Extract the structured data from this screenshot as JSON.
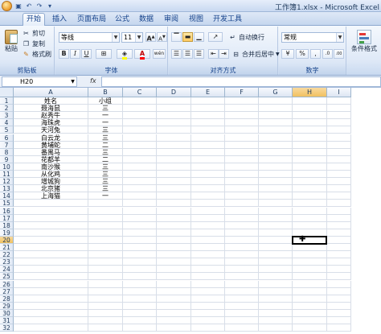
{
  "window": {
    "title": "工作簿1.xlsx - Microsoft Excel"
  },
  "tabs": [
    {
      "label": "开始",
      "active": true
    },
    {
      "label": "插入",
      "active": false
    },
    {
      "label": "页面布局",
      "active": false
    },
    {
      "label": "公式",
      "active": false
    },
    {
      "label": "数据",
      "active": false
    },
    {
      "label": "审阅",
      "active": false
    },
    {
      "label": "视图",
      "active": false
    },
    {
      "label": "开发工具",
      "active": false
    }
  ],
  "ribbon": {
    "clipboard": {
      "label": "剪贴板",
      "paste": "粘贴",
      "cut": "剪切",
      "copy": "复制",
      "format_painter": "格式刷"
    },
    "font": {
      "label": "字体",
      "font_name": "等线",
      "font_size": "11",
      "bold": "B",
      "italic": "I",
      "underline": "U",
      "grow": "A",
      "shrink": "A",
      "color_letter": "A",
      "wen": "wén"
    },
    "alignment": {
      "label": "对齐方式",
      "wrap": "自动换行",
      "merge": "合并后居中"
    },
    "number": {
      "label": "数字",
      "format": "常规",
      "currency": "¥",
      "percent": "%",
      "comma": ",",
      "inc_dec": ".0",
      "dec_dec": ".00"
    },
    "styles": {
      "conditional": "条件格式"
    }
  },
  "formula_bar": {
    "name_box": "H20",
    "fx": "fx",
    "value": ""
  },
  "sheet": {
    "columns": [
      "A",
      "B",
      "C",
      "D",
      "E",
      "F",
      "G",
      "H",
      "I"
    ],
    "selected_column": "H",
    "selected_row": 20,
    "active_cell": "H20",
    "rows": [
      {
        "n": "1",
        "a": "姓名",
        "b": "小组"
      },
      {
        "n": "2",
        "a": "聂海鼠",
        "b": "三"
      },
      {
        "n": "3",
        "a": "赵秀牛",
        "b": "一"
      },
      {
        "n": "4",
        "a": "海珠虎",
        "b": "一"
      },
      {
        "n": "5",
        "a": "天河兔",
        "b": "三"
      },
      {
        "n": "6",
        "a": "白云龙",
        "b": "三"
      },
      {
        "n": "7",
        "a": "黄埔蛇",
        "b": "二"
      },
      {
        "n": "8",
        "a": "番禺马",
        "b": "三"
      },
      {
        "n": "9",
        "a": "花都羊",
        "b": "二"
      },
      {
        "n": "10",
        "a": "南沙猴",
        "b": "三"
      },
      {
        "n": "11",
        "a": "从化鸡",
        "b": "三"
      },
      {
        "n": "12",
        "a": "增城狗",
        "b": "三"
      },
      {
        "n": "13",
        "a": "北京猪",
        "b": "三"
      },
      {
        "n": "14",
        "a": "上海猫",
        "b": "一"
      },
      {
        "n": "15",
        "a": "",
        "b": ""
      },
      {
        "n": "16",
        "a": "",
        "b": ""
      },
      {
        "n": "17",
        "a": "",
        "b": ""
      },
      {
        "n": "18",
        "a": "",
        "b": ""
      },
      {
        "n": "19",
        "a": "",
        "b": ""
      },
      {
        "n": "20",
        "a": "",
        "b": ""
      },
      {
        "n": "21",
        "a": "",
        "b": ""
      },
      {
        "n": "22",
        "a": "",
        "b": ""
      },
      {
        "n": "23",
        "a": "",
        "b": ""
      },
      {
        "n": "24",
        "a": "",
        "b": ""
      },
      {
        "n": "25",
        "a": "",
        "b": ""
      },
      {
        "n": "26",
        "a": "",
        "b": ""
      },
      {
        "n": "27",
        "a": "",
        "b": ""
      },
      {
        "n": "28",
        "a": "",
        "b": ""
      },
      {
        "n": "29",
        "a": "",
        "b": ""
      },
      {
        "n": "30",
        "a": "",
        "b": ""
      },
      {
        "n": "31",
        "a": "",
        "b": ""
      },
      {
        "n": "32",
        "a": "",
        "b": ""
      }
    ]
  }
}
